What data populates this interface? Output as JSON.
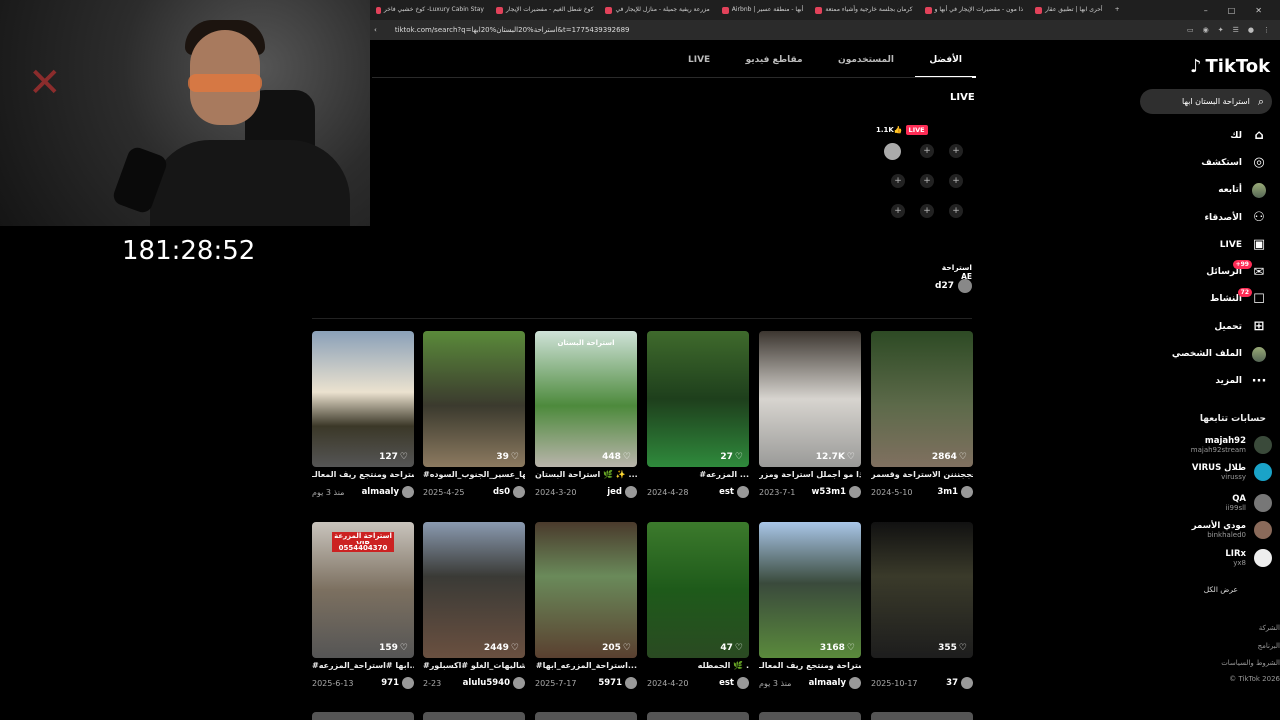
{
  "browser": {
    "tabs": [
      {
        "label": "كوخ خشبي فاخر -Luxury Cabin Stay"
      },
      {
        "label": "كوخ شطل الغيم - مفضيرات الإيجار"
      },
      {
        "label": "مزرعة ريفية جميلة - منازل للإيجار في"
      },
      {
        "label": "Airbnb | أبها - منطقة عسير"
      },
      {
        "label": "كرمان بجلسة خارجية وأشياء ممتعة"
      },
      {
        "label": "ذا مون - مقضيرات الإيجار في أبها و"
      },
      {
        "label": "أحرى ابها | تطبيق عقار"
      }
    ],
    "new_tab": "+",
    "url": "tiktok.com/search?q=استراحة%20البستان%20ابها&t=1775439392689"
  },
  "stream": {
    "timer": "181:28:52"
  },
  "sidebar": {
    "logo": "TikTok",
    "search_value": "استراحة البستان ابها",
    "nav": [
      {
        "label": "لك",
        "icon": "home-icon",
        "glyph": "⌂"
      },
      {
        "label": "استكشف",
        "icon": "compass-icon",
        "glyph": "◎"
      },
      {
        "label": "أتابعه",
        "icon": "following-avatar-icon",
        "glyph": ""
      },
      {
        "label": "الأصدقاء",
        "icon": "friends-icon",
        "glyph": "⚇"
      },
      {
        "label": "LIVE",
        "icon": "live-icon",
        "glyph": "▣"
      },
      {
        "label": "الرسائل",
        "icon": "messages-icon",
        "glyph": "✉",
        "badge": "+99"
      },
      {
        "label": "النشاط",
        "icon": "activity-icon",
        "glyph": "☐",
        "badge": "72"
      },
      {
        "label": "تحميل",
        "icon": "upload-icon",
        "glyph": "⊞"
      },
      {
        "label": "الملف الشخصي",
        "icon": "profile-avatar-icon",
        "glyph": "●"
      },
      {
        "label": "المزيد",
        "icon": "more-icon",
        "glyph": "···"
      }
    ],
    "following_title": "حسابات تتابعها",
    "accounts": [
      {
        "name": "majah92",
        "handle": "majah92stream",
        "color": "#3a4a3a"
      },
      {
        "name": "VIRUS طلال",
        "handle": "virussy",
        "color": "#1aa3c8"
      },
      {
        "name": "QA",
        "handle": "ii99sll",
        "color": "#777"
      },
      {
        "name": "مودي الأسمر",
        "handle": "binkhaled0",
        "color": "#8a6a5a"
      },
      {
        "name": "LIRx",
        "handle": "yx8",
        "color": "#eee"
      }
    ],
    "show_all": "عرض الكل",
    "footer": [
      "الشركة",
      "البرنامج",
      "الشروط والسياسات",
      "© TikTok 2026"
    ]
  },
  "search_tabs": [
    {
      "label": "الأفضل",
      "active": true
    },
    {
      "label": "المستخدمون",
      "active": false
    },
    {
      "label": "مقاطع فيديو",
      "active": false
    },
    {
      "label": "LIVE",
      "active": false
    }
  ],
  "live_section": {
    "heading": "LIVE",
    "viewers": "1.1K👍",
    "badge": "LIVE",
    "add": "+"
  },
  "result_user": {
    "title": "استراحة AE",
    "username": "d27"
  },
  "videos": [
    {
      "likes": "2864",
      "caption": "تجججنننن الاستراحة وقسمر...",
      "date": "2024-5-10",
      "user": "3m1",
      "bg": "linear-gradient(#2d4a24,#5d6a4a 55%,#807060)"
    },
    {
      "likes": "12.7K",
      "caption": "اذا مو أجملل استراحة ومزر...",
      "date": "2023-7-1",
      "user": "w53m1",
      "bg": "linear-gradient(#3c3630,#d7d4cf 50%,#9a9a98)"
    },
    {
      "likes": "27",
      "caption": "#المزرعه ...",
      "date": "2024-4-28",
      "user": "est",
      "bg": "linear-gradient(#3f6a2c,#1e3f1c 50%,#2f8a3c)"
    },
    {
      "likes": "448",
      "caption": "استراحة البستان 🌿 ✨ ...",
      "date": "2024-3-20",
      "user": "jed",
      "bg": "linear-gradient(#cfe2d8,#4d8a3c 55%,#b9b4ab)"
    },
    {
      "likes": "39",
      "caption": "#ابها_عسير_الجنوب_السوده",
      "date": "2025-4-25",
      "user": "ds0",
      "bg": "linear-gradient(#5a8a3a,#3b3a2e 55%,#8c7a60)"
    },
    {
      "likes": "127",
      "caption": "استراحة ومنتجع ريف المعالـ...",
      "date": "منذ 3 يوم",
      "user": "almaaly",
      "bg": "linear-gradient(#8aa0b8,#ebe2cf 45%,#3b3828 70%,#555)"
    },
    {
      "likes": "355",
      "caption": "",
      "date": "2025-10-17",
      "user": "37",
      "bg": "linear-gradient(#111,#3a3a2a 40%,#1d1d1d)"
    },
    {
      "likes": "3168",
      "caption": "استراحة ومنتجع ريف المعالـ...",
      "date": "منذ 3 يوم",
      "user": "almaaly",
      "bg": "linear-gradient(#a9c6e8,#3a4a3c 45%,#5a8a3c)"
    },
    {
      "likes": "47",
      "caption": "الحمطله 🌿 .",
      "date": "2024-4-20",
      "user": "est",
      "bg": "linear-gradient(#3c7a2c,#1e5a1a 50%,#2a4a22)"
    },
    {
      "likes": "205",
      "caption": "#استراحة_المزرعه_ابها...",
      "date": "2025-7-17",
      "user": "5971",
      "bg": "linear-gradient(#4a3a2c,#6a8a5a 40%,#5a4030)"
    },
    {
      "likes": "2449",
      "caption": "#شاليهات_الغلو #اكسبلور...",
      "date": "2-23",
      "user": "alulu5940",
      "bg": "linear-gradient(#8a9ab0,#3a3a36 40%,#6a5040)"
    },
    {
      "likes": "159",
      "caption": "#ابها #استراحة_المزرعه...",
      "date": "2025-6-13",
      "user": "971",
      "bg": "linear-gradient(#c9c4bd,#7c7060 50%,#555)"
    }
  ],
  "overlays": {
    "v4": "استراحة البستان",
    "v12_line1": "استراحة المزرعة VIP",
    "v12_line2": "0554404370"
  },
  "colors": {
    "accent": "#fe2c55",
    "bg": "#000000"
  }
}
